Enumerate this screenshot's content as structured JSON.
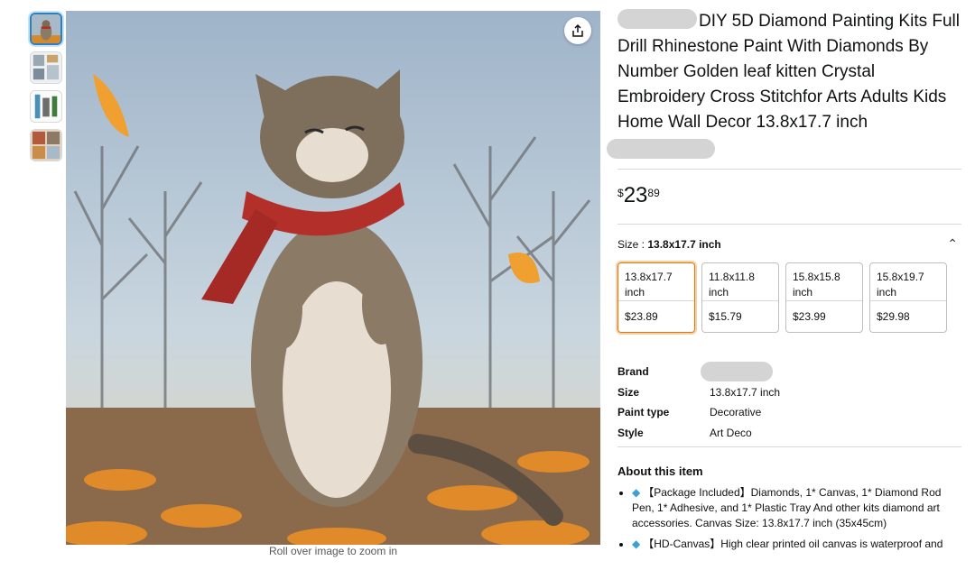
{
  "gallery": {
    "thumbnails": [
      "thumbnail-cat",
      "thumbnail-kit-contents",
      "thumbnail-tools",
      "thumbnail-detail"
    ],
    "zoom_hint": "Roll over image to zoom in"
  },
  "product": {
    "title": "DIY 5D Diamond Painting Kits Full Drill Rhinestone Paint With Diamonds By Number Golden leaf kitten Crystal Embroidery Cross Stitchfor Arts Adults Kids Home Wall Decor 13.8x17.7 inch",
    "price": {
      "symbol": "$",
      "whole": "23",
      "fraction": "89"
    }
  },
  "size_selector": {
    "label": "Size : ",
    "selected": "13.8x17.7 inch",
    "options": [
      {
        "size": "13.8x17.7 inch",
        "price": "$23.89"
      },
      {
        "size": "11.8x11.8 inch",
        "price": "$15.79"
      },
      {
        "size": "15.8x15.8 inch",
        "price": "$23.99"
      },
      {
        "size": "15.8x19.7 inch",
        "price": "$29.98"
      }
    ]
  },
  "specs": {
    "brand_label": "Brand",
    "size_label": "Size",
    "size_value": "13.8x17.7 inch",
    "paint_type_label": "Paint type",
    "paint_type_value": "Decorative",
    "style_label": "Style",
    "style_value": "Art Deco"
  },
  "about": {
    "heading": "About this item",
    "bullets": [
      "【Package Included】Diamonds, 1* Canvas, 1* Diamond Rod Pen, 1* Adhesive, and 1* Plastic Tray And other kits diamond art accessories. Canvas Size: 13.8x17.7 inch (35x45cm)",
      "【HD-Canvas】High clear printed oil canvas is waterproof and"
    ]
  },
  "colors": {
    "accent_selected": "#e77600",
    "link": "#2f7fbf",
    "divider": "#d5d9d9"
  }
}
